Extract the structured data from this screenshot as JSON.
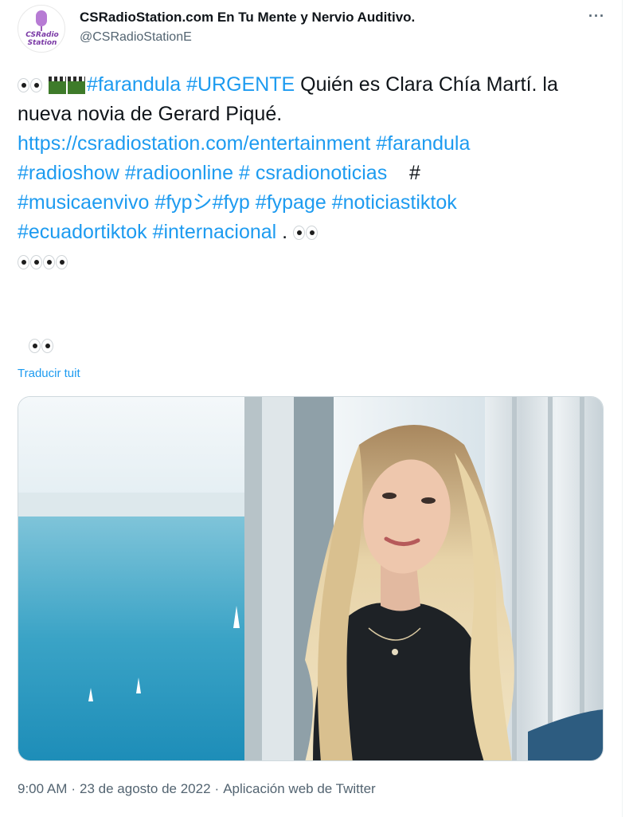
{
  "author": {
    "display_name": "CSRadioStation.com En Tu Mente y Nervio Auditivo.",
    "handle": "@CSRadioStationE",
    "avatar_brand_line1": "CSRadio",
    "avatar_brand_line2": "Station"
  },
  "menu": {
    "more_label": "···"
  },
  "tweet": {
    "hashtag_farandula": "#farandula",
    "hashtag_urgente": "#URGENTE",
    "text_intro": " Quién es Clara Chía Martí. la nueva novia de Gerard Piqué.",
    "url": "https://csradiostation.com/entertainment",
    "hashtag_farandula2": "#farandula",
    "hashtag_radioshow": "#radioshow",
    "hashtag_radioonline": "#radioonline",
    "hashtag_space": "# csradionoticias",
    "hash_alone": "#",
    "hashtag_musicaenvivo": "#musicaenvivo",
    "hashtag_fyp_shi": "#fypシ",
    "hashtag_fyp": "#fyp",
    "hashtag_fypage": "#fypage",
    "hashtag_noticiastiktok": "#noticiastiktok",
    "hashtag_ecuadortiktok": "#ecuadortiktok",
    "hashtag_internacional": "#internacional",
    "period": " ."
  },
  "translate_label": "Traducir tuit",
  "footer": {
    "time": "9:00 AM",
    "date": "23 de agosto de 2022",
    "source": "Aplicación web de Twitter",
    "separator": "·"
  },
  "colors": {
    "link": "#1d9bf0",
    "text": "#0f1419",
    "muted": "#536471"
  }
}
